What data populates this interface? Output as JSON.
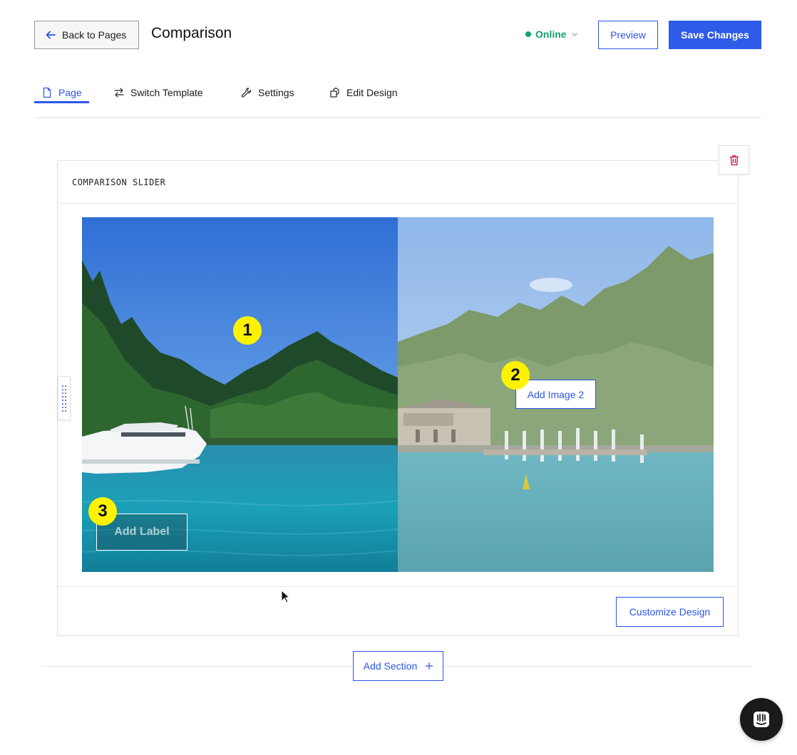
{
  "header": {
    "back_label": "Back to Pages",
    "page_title": "Comparison",
    "status_label": "Online",
    "preview_label": "Preview",
    "save_label": "Save Changes"
  },
  "tabs": [
    {
      "label": "Page",
      "icon": "page-icon",
      "active": true
    },
    {
      "label": "Switch Template",
      "icon": "switch-icon",
      "active": false
    },
    {
      "label": "Settings",
      "icon": "wrench-icon",
      "active": false
    },
    {
      "label": "Edit Design",
      "icon": "design-icon",
      "active": false
    }
  ],
  "section": {
    "title": "COMPARISON SLIDER",
    "add_image_2_label": "Add Image 2",
    "add_label": "Add Label",
    "customize_label": "Customize Design"
  },
  "markers": [
    "1",
    "2",
    "3"
  ],
  "add_section_label": "Add Section",
  "colors": {
    "accent": "#2a56e8",
    "status": "#11a36a",
    "marker": "#fff200",
    "delete": "#c0143c"
  }
}
